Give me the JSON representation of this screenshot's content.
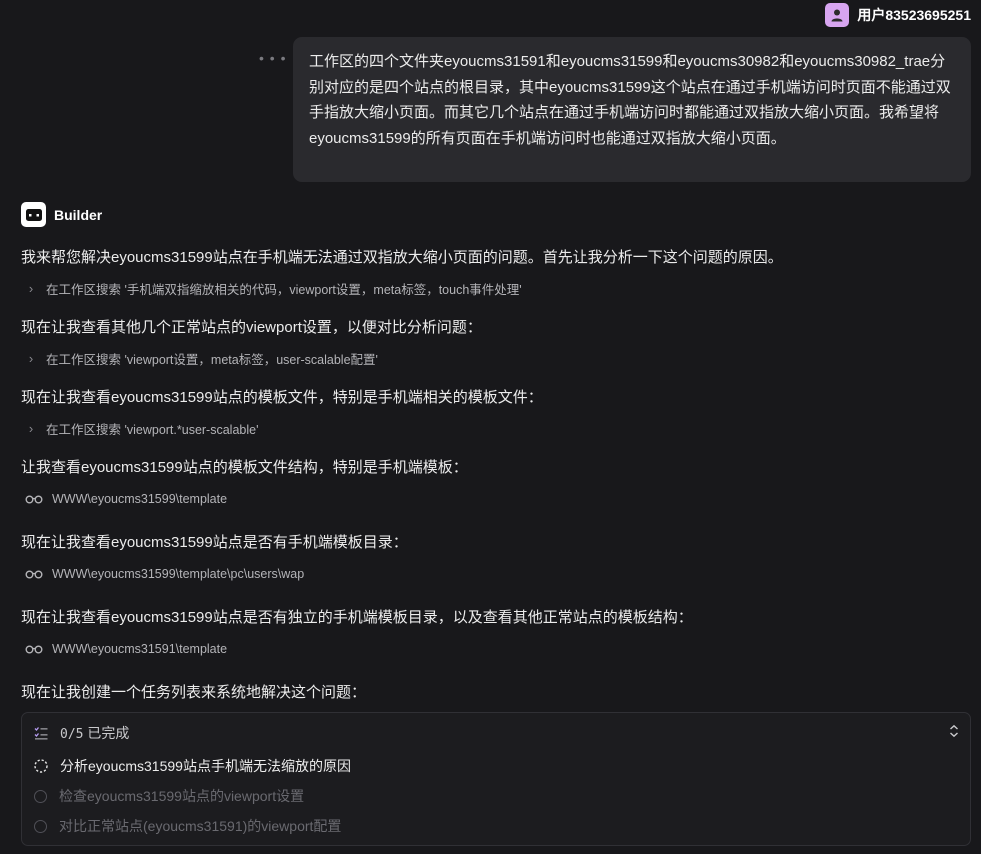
{
  "user": {
    "name": "用户83523695251",
    "avatar_icon": "user-icon"
  },
  "user_message": "工作区的四个文件夹eyoucms31591和eyoucms31599和eyoucms30982和eyoucms30982_trae分别对应的是四个站点的根目录，其中eyoucms31599这个站点在通过手机端访问时页面不能通过双手指放大缩小页面。而其它几个站点在通过手机端访问时都能通过双指放大缩小页面。我希望将eyoucms31599的所有页面在手机端访问时也能通过双指放大缩小页面。",
  "more_icon": "more-dots-icon",
  "assistant": {
    "name": "Builder",
    "logo_icon": "builder-logo-icon"
  },
  "messages": [
    "我来帮您解决eyoucms31599站点在手机端无法通过双指放大缩小页面的问题。首先让我分析一下这个问题的原因。",
    "现在让我查看其他几个正常站点的viewport设置，以便对比分析问题：",
    "现在让我查看eyoucms31599站点的模板文件，特别是手机端相关的模板文件：",
    "让我查看eyoucms31599站点的模板文件结构，特别是手机端模板：",
    "现在让我查看eyoucms31599站点是否有手机端模板目录：",
    "现在让我查看eyoucms31599站点是否有独立的手机端模板目录，以及查看其他正常站点的模板结构：",
    "现在让我创建一个任务列表来系统地解决这个问题："
  ],
  "searches": [
    "在工作区搜索 '手机端双指缩放相关的代码，viewport设置，meta标签，touch事件处理'",
    "在工作区搜索 'viewport设置，meta标签，user-scalable配置'",
    "在工作区搜索 'viewport.*user-scalable'"
  ],
  "paths": [
    "WWW\\eyoucms31599\\template",
    "WWW\\eyoucms31599\\template\\pc\\users\\wap",
    "WWW\\eyoucms31591\\template"
  ],
  "tasks": {
    "progress": "0/5",
    "status": "已完成",
    "items": [
      {
        "label": "分析eyoucms31599站点手机端无法缩放的原因",
        "state": "in-progress"
      },
      {
        "label": "检查eyoucms31599站点的viewport设置",
        "state": "pending"
      },
      {
        "label": "对比正常站点(eyoucms31591)的viewport配置",
        "state": "pending"
      }
    ]
  },
  "colors": {
    "background": "#18181b",
    "bubble": "#2a2a2e",
    "avatar": "#d7a5f0",
    "accent": "#b59cf0"
  }
}
